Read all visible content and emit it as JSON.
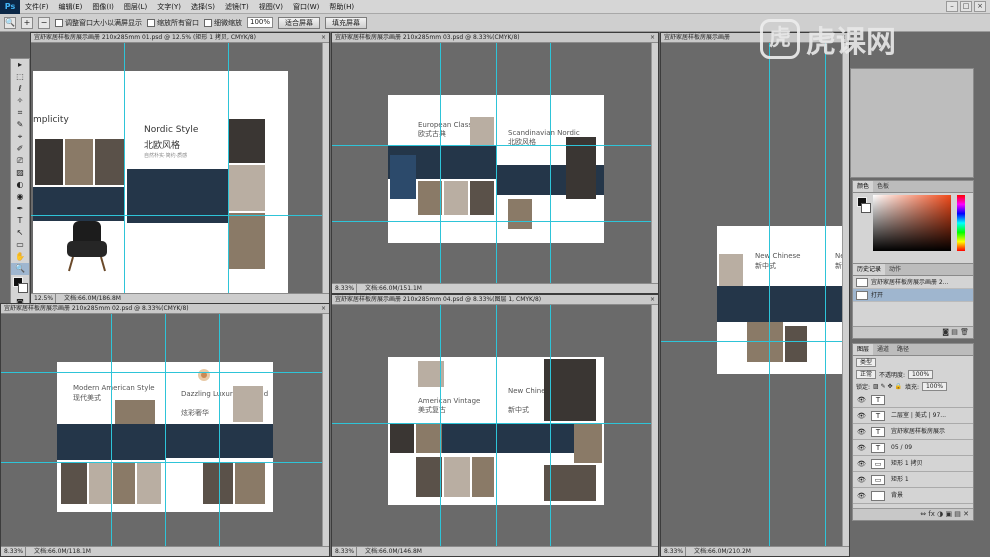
{
  "app": {
    "logo": "Ps",
    "accent": "#43b5f7"
  },
  "menu": [
    "文件(F)",
    "编辑(E)",
    "图像(I)",
    "图层(L)",
    "文字(Y)",
    "选择(S)",
    "滤镜(T)",
    "视图(V)",
    "窗口(W)",
    "帮助(H)"
  ],
  "window_controls": [
    "–",
    "□",
    "×"
  ],
  "options": {
    "check1": "调整窗口大小以满屏显示",
    "check2": "缩放所有窗口",
    "check3": "细微缩放",
    "zoom_value": "100%",
    "btn_fit": "适合屏幕",
    "btn_fill": "填充屏幕"
  },
  "tools": [
    "▸",
    "⬚",
    "ℓ",
    "✧",
    "⌗",
    "✎",
    "⌖",
    "✐",
    "⎚",
    "▨",
    "◐",
    "◉",
    "✒",
    "T",
    "↖",
    "▭",
    "✋",
    "🔍"
  ],
  "documents": [
    {
      "tab": "宜舒家居样板房展示画册 210x285mm 01.psd @ 12.5% (矩形 1 拷贝, CMYK/8)",
      "zoom": "12.5%",
      "status": "文档:66.0M/186.8M"
    },
    {
      "tab": "宜舒家居样板房展示画册 210x285mm 03.psd @ 8.33%(CMYK/8)",
      "zoom": "8.33%",
      "status": "文档:66.0M/151.1M"
    },
    {
      "tab": "宜舒家居样板房展示画册 210x285mm 02.psd @ 8.33%(CMYK/8)",
      "zoom": "8.33%",
      "status": "文档:66.0M/118.1M"
    },
    {
      "tab": "宜舒家居样板房展示画册 210x285mm 04.psd @ 8.33%(图层 1, CMYK/8)",
      "zoom": "8.33%",
      "status": "文档:66.0M/146.8M"
    },
    {
      "tab": "宜舒家居样板房展示画册",
      "zoom": "8.33%",
      "status": "文档:66.0M/210.2M"
    }
  ],
  "page_text": {
    "d1_left": "mplicity",
    "d1_title": "Nordic Style",
    "d1_cn": "北欧风格",
    "d1_sub": "自然朴实·简约·质感",
    "d2_title1": "European Classic",
    "d2_cn1": "欧式古典",
    "d2_title2": "Scandinavian Nordic",
    "d2_cn2": "北欧风格",
    "d3_title1": "Modern American Style",
    "d3_cn1": "现代美式",
    "d3_title2": "Dazzling Luxury Emerald",
    "d3_cn2": "炫彩奢华",
    "d4_title1": "American Vintage",
    "d4_cn1": "美式复古",
    "d4_title2": "New Chinese Style",
    "d4_cn2": "新中式",
    "d5_title1": "New Chinese",
    "d5_cn1": "新中式",
    "d5_title2": "New Cl",
    "d5_cn2": "新古"
  },
  "watermark": {
    "icon": "虎",
    "text": "虎课网"
  },
  "color_panel": {
    "tabs": [
      "颜色",
      "色板"
    ]
  },
  "history_panel": {
    "tabs": [
      "历史记录",
      "动作"
    ],
    "items": [
      "宜舒家居样板房展示画册 2...",
      "打开"
    ]
  },
  "layers_panel": {
    "tabs": [
      "图层",
      "通道",
      "路径"
    ],
    "filter": "类型",
    "blend": "正常",
    "opacity_label": "不透明度:",
    "opacity": "100%",
    "lock_label": "锁定:",
    "fill_label": "填充:",
    "fill": "100%",
    "layers": [
      {
        "thumb": "T",
        "name": ""
      },
      {
        "thumb": "T",
        "name": "二层室 | 美式 | 97..."
      },
      {
        "thumb": "T",
        "name": "宜舒家居样板房展示"
      },
      {
        "thumb": "T",
        "name": "05 / 09"
      },
      {
        "thumb": "▭",
        "name": "矩形 1 拷贝"
      },
      {
        "thumb": "▭",
        "name": "矩形 1"
      },
      {
        "thumb": "",
        "name": "背景"
      }
    ],
    "footer": "⇔ fx ◑ ▣ ▤ ✕"
  }
}
